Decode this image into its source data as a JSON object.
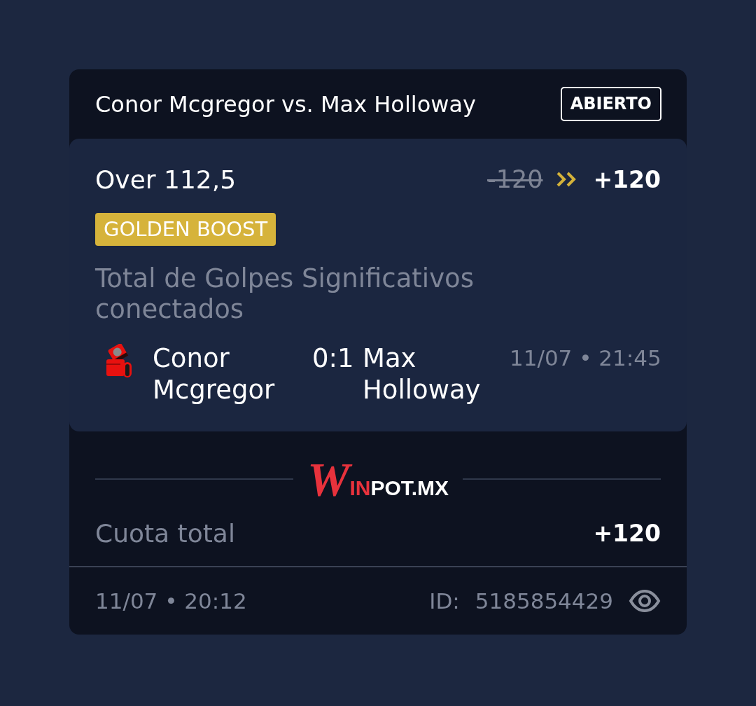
{
  "ticket": {
    "title": "Conor Mcgregor vs. Max Holloway",
    "status": "ABIERTO"
  },
  "selection": {
    "pick": "Over 112,5",
    "old_odds": "-120",
    "odds": "+120",
    "boost": "GOLDEN BOOST",
    "market": "Total de Golpes Significativos conectados",
    "home": "Conor Mcgregor",
    "score": "0:1",
    "away": "Max Holloway",
    "event_time": "11/07 • 21:45"
  },
  "logo": {
    "script": "W",
    "accent": "IN",
    "rest": "POT.MX"
  },
  "total": {
    "label": "Cuota total",
    "odds": "+120"
  },
  "footer": {
    "placed": "11/07 • 20:12",
    "id_label": "ID:",
    "id": "5185854429"
  }
}
